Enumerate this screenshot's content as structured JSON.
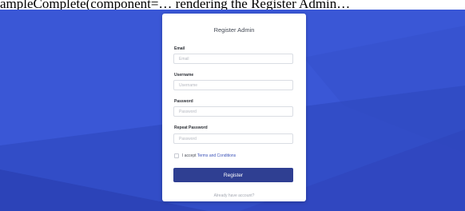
{
  "caption": "ampleComplete(component=… rendering the Register Admin…",
  "card": {
    "title": "Register Admin"
  },
  "form": {
    "email_label": "Email",
    "email_placeholder": "Email",
    "username_label": "Username",
    "username_placeholder": "Username",
    "password_label": "Password",
    "password_placeholder": "Password",
    "repeat_password_label": "Repeat Password",
    "repeat_password_placeholder": "Password",
    "terms_prefix": "I accept",
    "terms_link": "Terms and Conditions",
    "terms_checked": false,
    "register_label": "Register",
    "already_account_text": "Already have account?"
  },
  "colors": {
    "background": "#3a57d6",
    "primary_button": "#2f3f92",
    "link": "#3a51b8"
  }
}
